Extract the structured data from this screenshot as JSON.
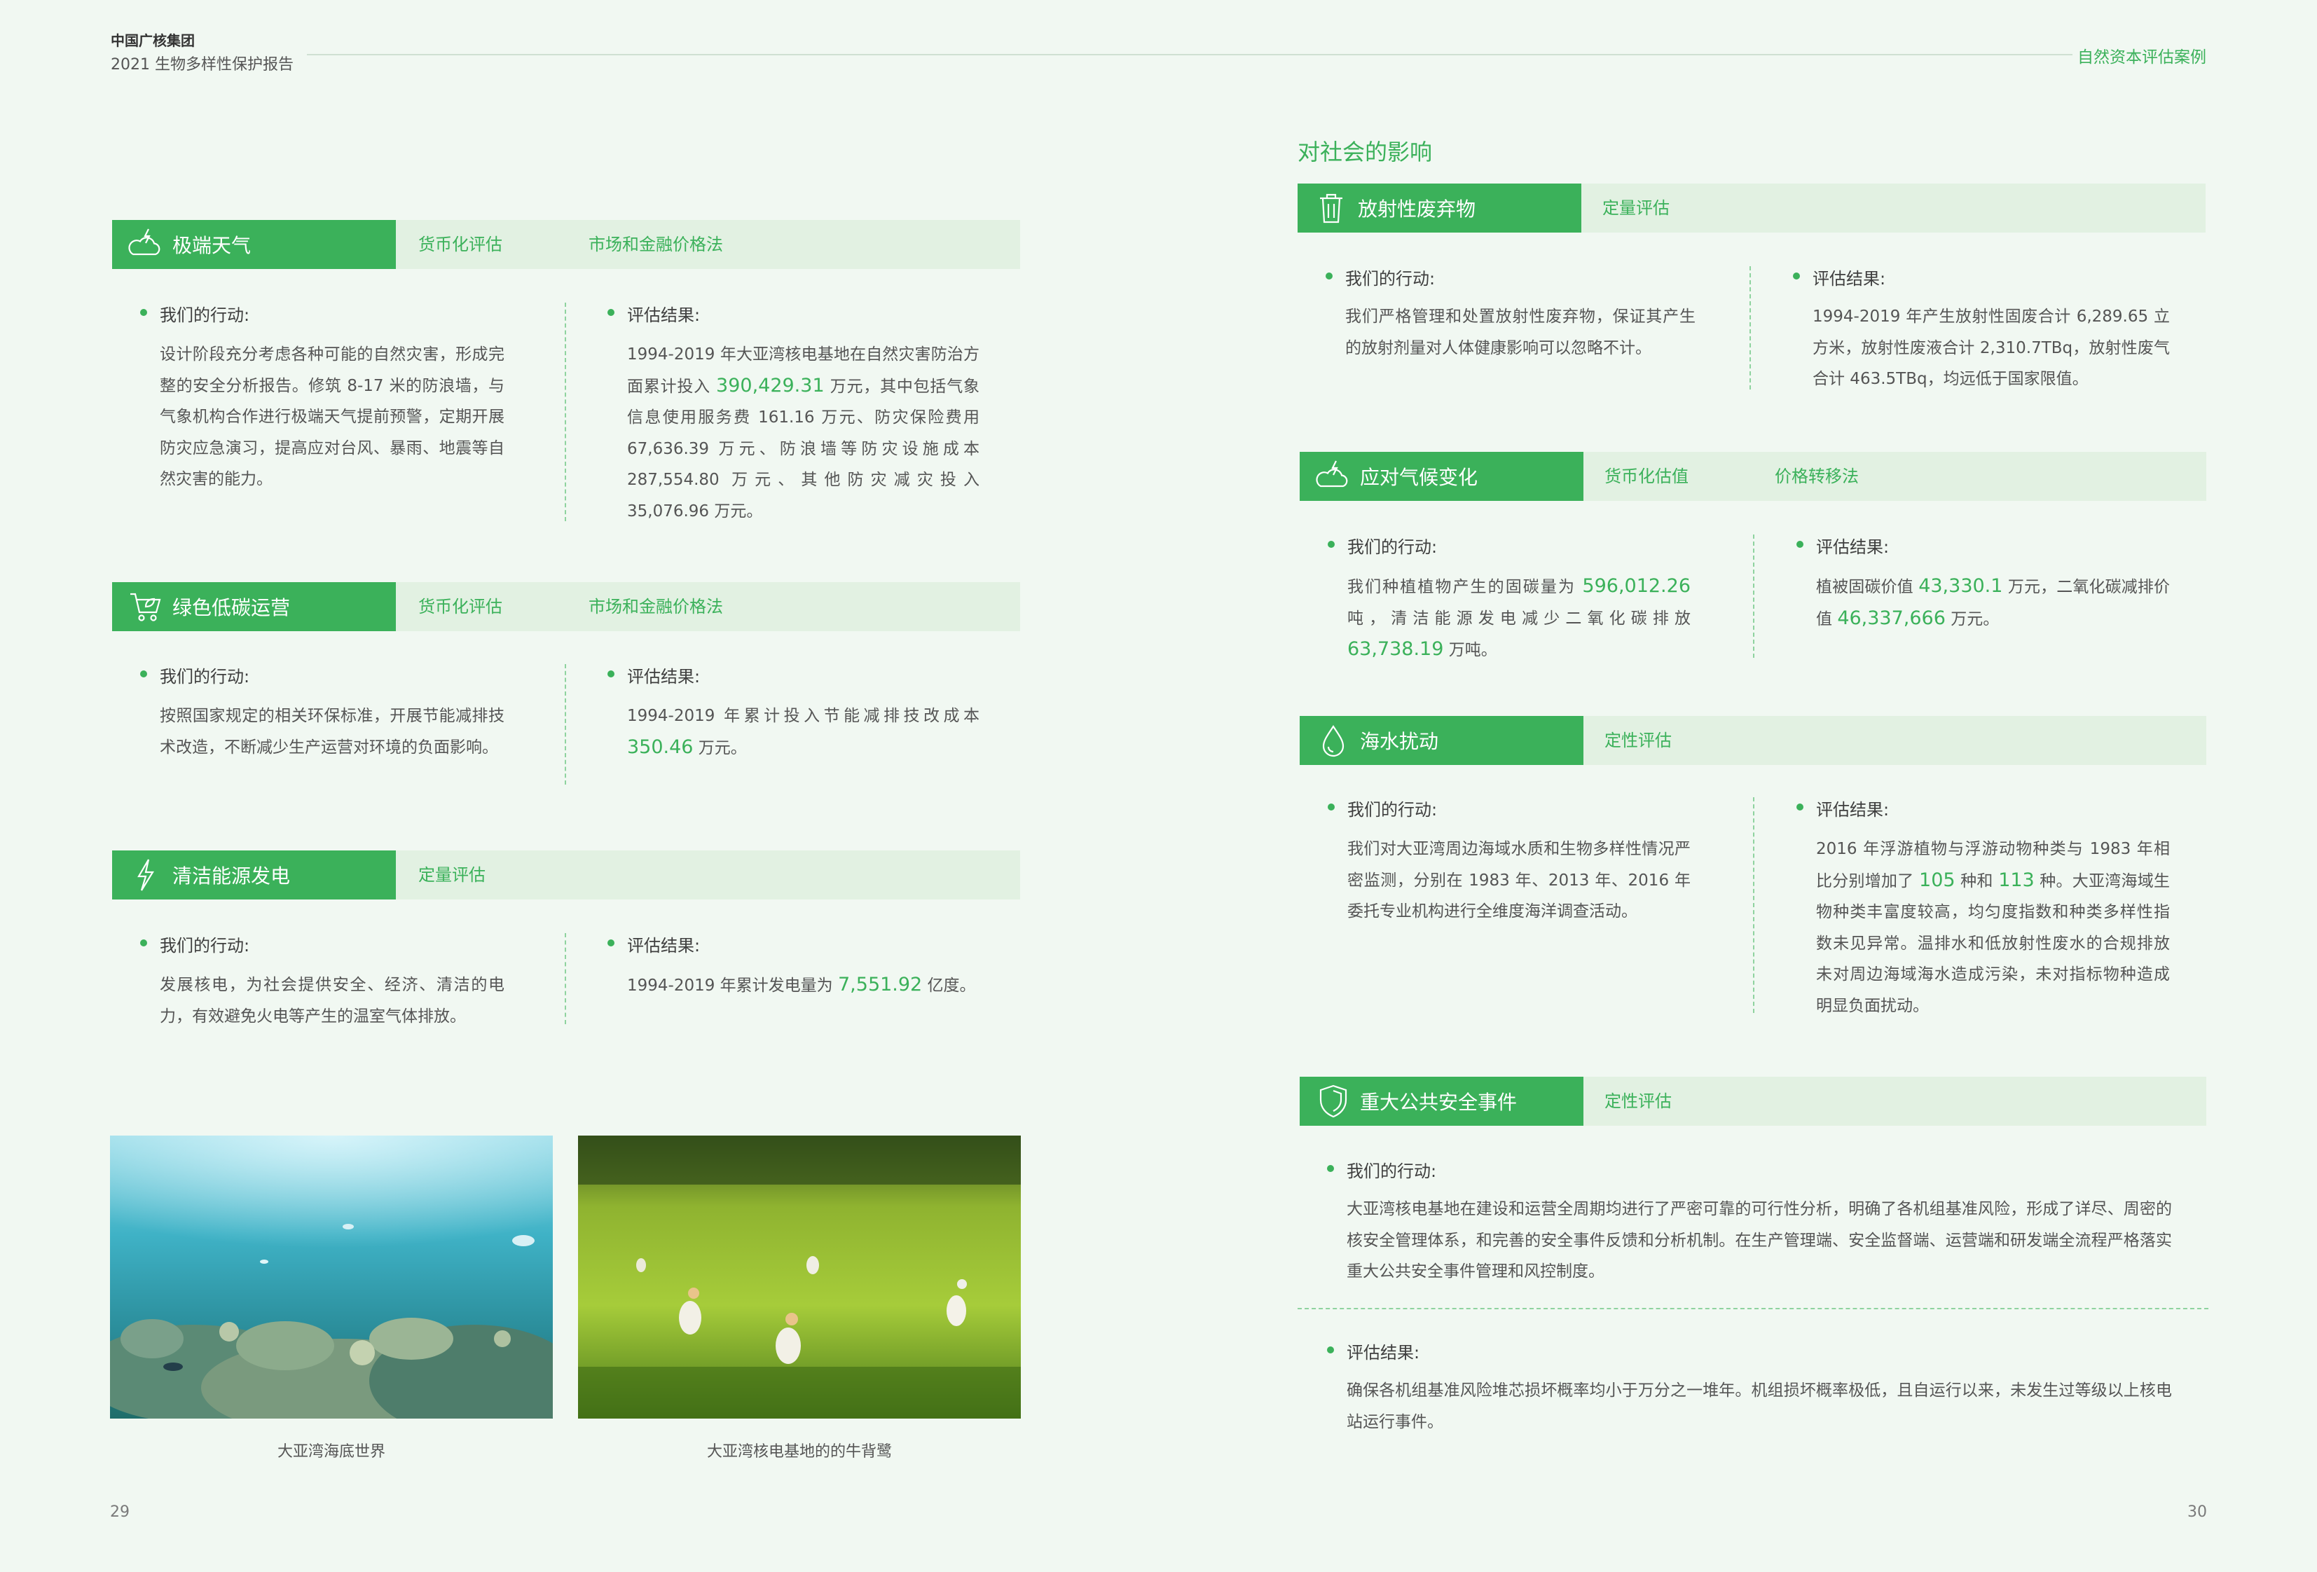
{
  "header": {
    "company": "中国广核集团",
    "report": "2021 生物多样性保护报告",
    "section": "自然资本评估案例"
  },
  "pages": {
    "left": "29",
    "right": "30"
  },
  "left_blocks": {
    "extreme_weather": {
      "title": "极端天气",
      "icon": "cloud-lightning-icon",
      "tags": [
        "货币化评估",
        "市场和金融价格法"
      ],
      "action_label": "我们的行动:",
      "action_text": "设计阶段充分考虑各种可能的自然灾害，形成完整的安全分析报告。修筑 8-17 米的防浪墙，与气象机构合作进行极端天气提前预警，定期开展防灾应急演习，提高应对台风、暴雨、地震等自然灾害的能力。",
      "result_label": "评估结果:",
      "result_pre": "1994-2019 年大亚湾核电基地在自然灾害防治方面累计投入 ",
      "result_value": "390,429.31",
      "result_post": " 万元，其中包括气象信息使用服务费 161.16 万元、防灾保险费用 67,636.39 万元、防浪墙等防灾设施成本 287,554.80 万元、其他防灾减灾投入 35,076.96 万元。"
    },
    "green_ops": {
      "title": "绿色低碳运营",
      "icon": "shopping-cart-leaf-icon",
      "tags": [
        "货币化评估",
        "市场和金融价格法"
      ],
      "action_label": "我们的行动:",
      "action_text": "按照国家规定的相关环保标准，开展节能减排技术改造，不断减少生产运营对环境的负面影响。",
      "result_label": "评估结果:",
      "result_pre": "1994-2019 年累计投入节能减排技改成本",
      "result_value": "350.46",
      "result_post": " 万元。"
    },
    "clean_energy": {
      "title": "清洁能源发电",
      "icon": "lightning-bolt-icon",
      "tags": [
        "定量评估"
      ],
      "action_label": "我们的行动:",
      "action_text": "发展核电，为社会提供安全、经济、清洁的电力，有效避免火电等产生的温室气体排放。",
      "result_label": "评估结果:",
      "result_pre": "1994-2019 年累计发电量为 ",
      "result_value": "7,551.92",
      "result_post": " 亿度。"
    }
  },
  "photos": {
    "underwater_caption": "大亚湾海底世界",
    "egrets_caption": "大亚湾核电基地的的牛背鹭"
  },
  "right_heading": "对社会的影响",
  "right_blocks": {
    "radioactive": {
      "title": "放射性废弃物",
      "icon": "trash-bin-icon",
      "tags": [
        "定量评估"
      ],
      "action_label": "我们的行动:",
      "action_text": "我们严格管理和处置放射性废弃物，保证其产生的放射剂量对人体健康影响可以忽略不计。",
      "result_label": "评估结果:",
      "result_text": "1994-2019 年产生放射性固废合计 6,289.65 立方米，放射性废液合计 2,310.7TBq，放射性废气合计 463.5TBq，均远低于国家限值。"
    },
    "climate": {
      "title": "应对气候变化",
      "icon": "cloud-lightning-icon",
      "tags": [
        "货币化估值",
        "价格转移法"
      ],
      "action_label": "我们的行动:",
      "action_pre": "我们种植植物产生的固碳量为 ",
      "action_v1": "596,012.26",
      "action_mid": " 吨，清洁能源发电减少二氧化碳排放 ",
      "action_v2": "63,738.19",
      "action_post": " 万吨。",
      "result_label": "评估结果:",
      "result_pre": "植被固碳价值 ",
      "result_v1": "43,330.1",
      "result_mid": " 万元，二氧化碳减排价值 ",
      "result_v2": "46,337,666",
      "result_post": " 万元。"
    },
    "seawater": {
      "title": "海水扰动",
      "icon": "water-drop-icon",
      "tags": [
        "定性评估"
      ],
      "action_label": "我们的行动:",
      "action_text": "我们对大亚湾周边海域水质和生物多样性情况严密监测，分别在 1983 年、2013 年、2016 年委托专业机构进行全维度海洋调查活动。",
      "result_label": "评估结果:",
      "result_pre": "2016 年浮游植物与浮游动物种类与 1983 年相比分别增加了 ",
      "result_v1": "105",
      "result_mid": " 种和 ",
      "result_v2": "113",
      "result_post": " 种。大亚湾海域生物种类丰富度较高，均匀度指数和种类多样性指数未见异常。温排水和低放射性废水的合规排放未对周边海域海水造成污染，未对指标物种造成明显负面扰动。"
    },
    "safety": {
      "title": "重大公共安全事件",
      "icon": "shield-icon",
      "tags": [
        "定性评估"
      ],
      "action_label": "我们的行动:",
      "action_text": "大亚湾核电基地在建设和运营全周期均进行了严密可靠的可行性分析，明确了各机组基准风险，形成了详尽、周密的核安全管理体系，和完善的安全事件反馈和分析机制。在生产管理端、安全监督端、运营端和研发端全流程严格落实重大公共安全事件管理和风控制度。",
      "result_label": "评估结果:",
      "result_text": "确保各机组基准风险堆芯损坏概率均小于万分之一堆年。机组损坏概率极低，且自运行以来，未发生过等级以上核电站运行事件。"
    }
  },
  "colors": {
    "accent": "#3bb15a",
    "bar_bg": "#e2f1e2",
    "page_bg": "#f1f8f2"
  }
}
